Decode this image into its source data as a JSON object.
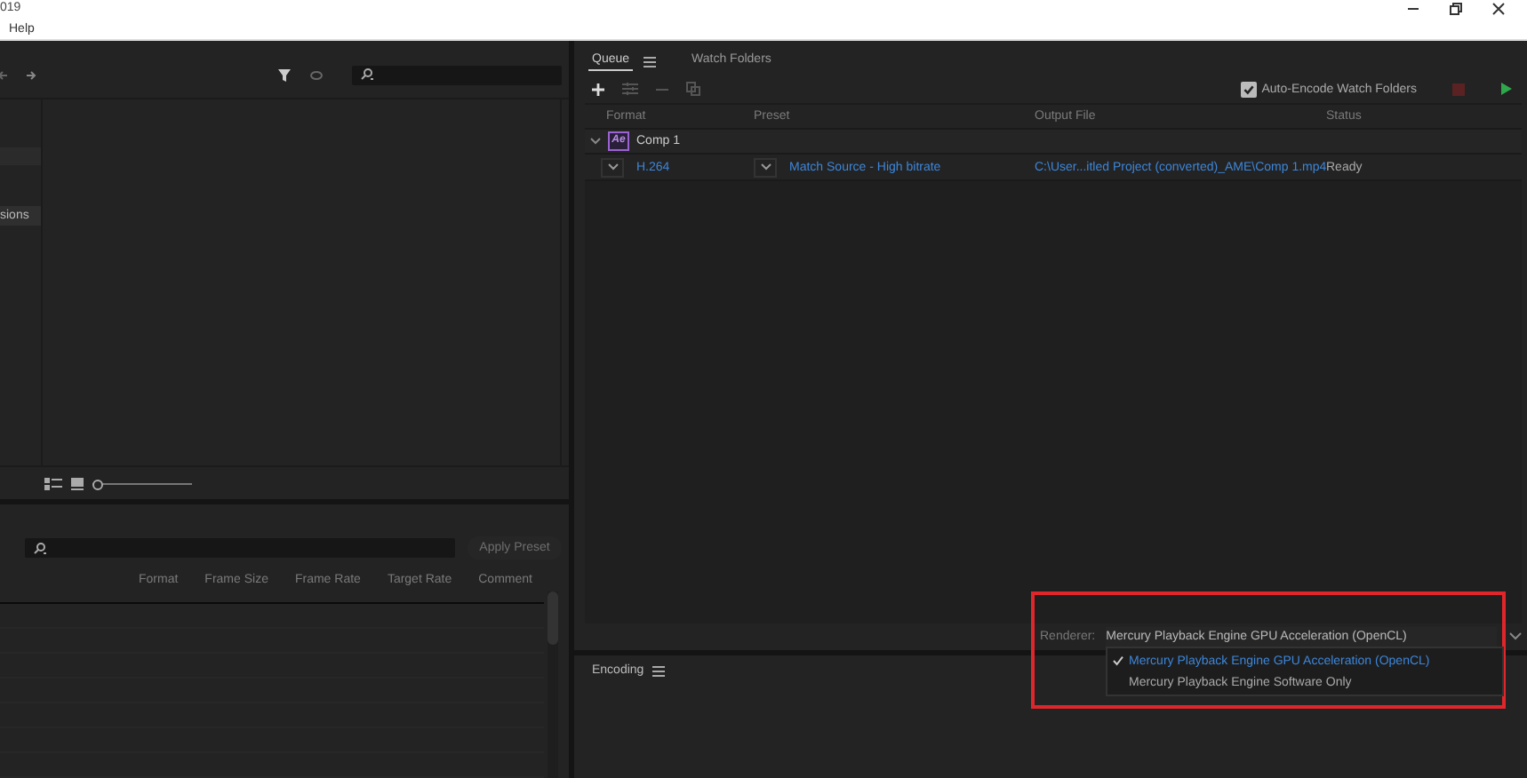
{
  "title_bar": {
    "title": "019"
  },
  "menu_bar": {
    "items": [
      "Help"
    ]
  },
  "media_browser": {
    "sidebar_items": [
      {
        "label": "sions",
        "selected": true
      }
    ],
    "zoom_slider": {
      "level": 0
    }
  },
  "preset_browser": {
    "apply_button": {
      "label": "Apply Preset",
      "disabled": true
    },
    "columns": [
      "Format",
      "Frame Size",
      "Frame Rate",
      "Target Rate",
      "Comment"
    ]
  },
  "queue": {
    "tabs": [
      {
        "label": "Queue",
        "selected": true
      },
      {
        "label": "Watch Folders",
        "selected": false
      }
    ],
    "auto_encode": {
      "label": "Auto-Encode Watch Folders",
      "checked": true
    },
    "columns": [
      "Format",
      "Preset",
      "Output File",
      "Status"
    ],
    "groups": [
      {
        "name": "Comp 1",
        "badge": "Ae",
        "expanded": true,
        "outputs": [
          {
            "format": "H.264",
            "preset": "Match Source - High bitrate",
            "output_file": "C:\\User...itled Project (converted)_AME\\Comp 1.mp4",
            "status": "Ready"
          }
        ]
      }
    ],
    "renderer": {
      "label": "Renderer:",
      "value": "Mercury Playback Engine GPU Acceleration (OpenCL)",
      "options": [
        {
          "label": "Mercury Playback Engine GPU Acceleration (OpenCL)",
          "selected": true
        },
        {
          "label": "Mercury Playback Engine Software Only",
          "selected": false
        }
      ]
    }
  },
  "encoding": {
    "title": "Encoding"
  }
}
